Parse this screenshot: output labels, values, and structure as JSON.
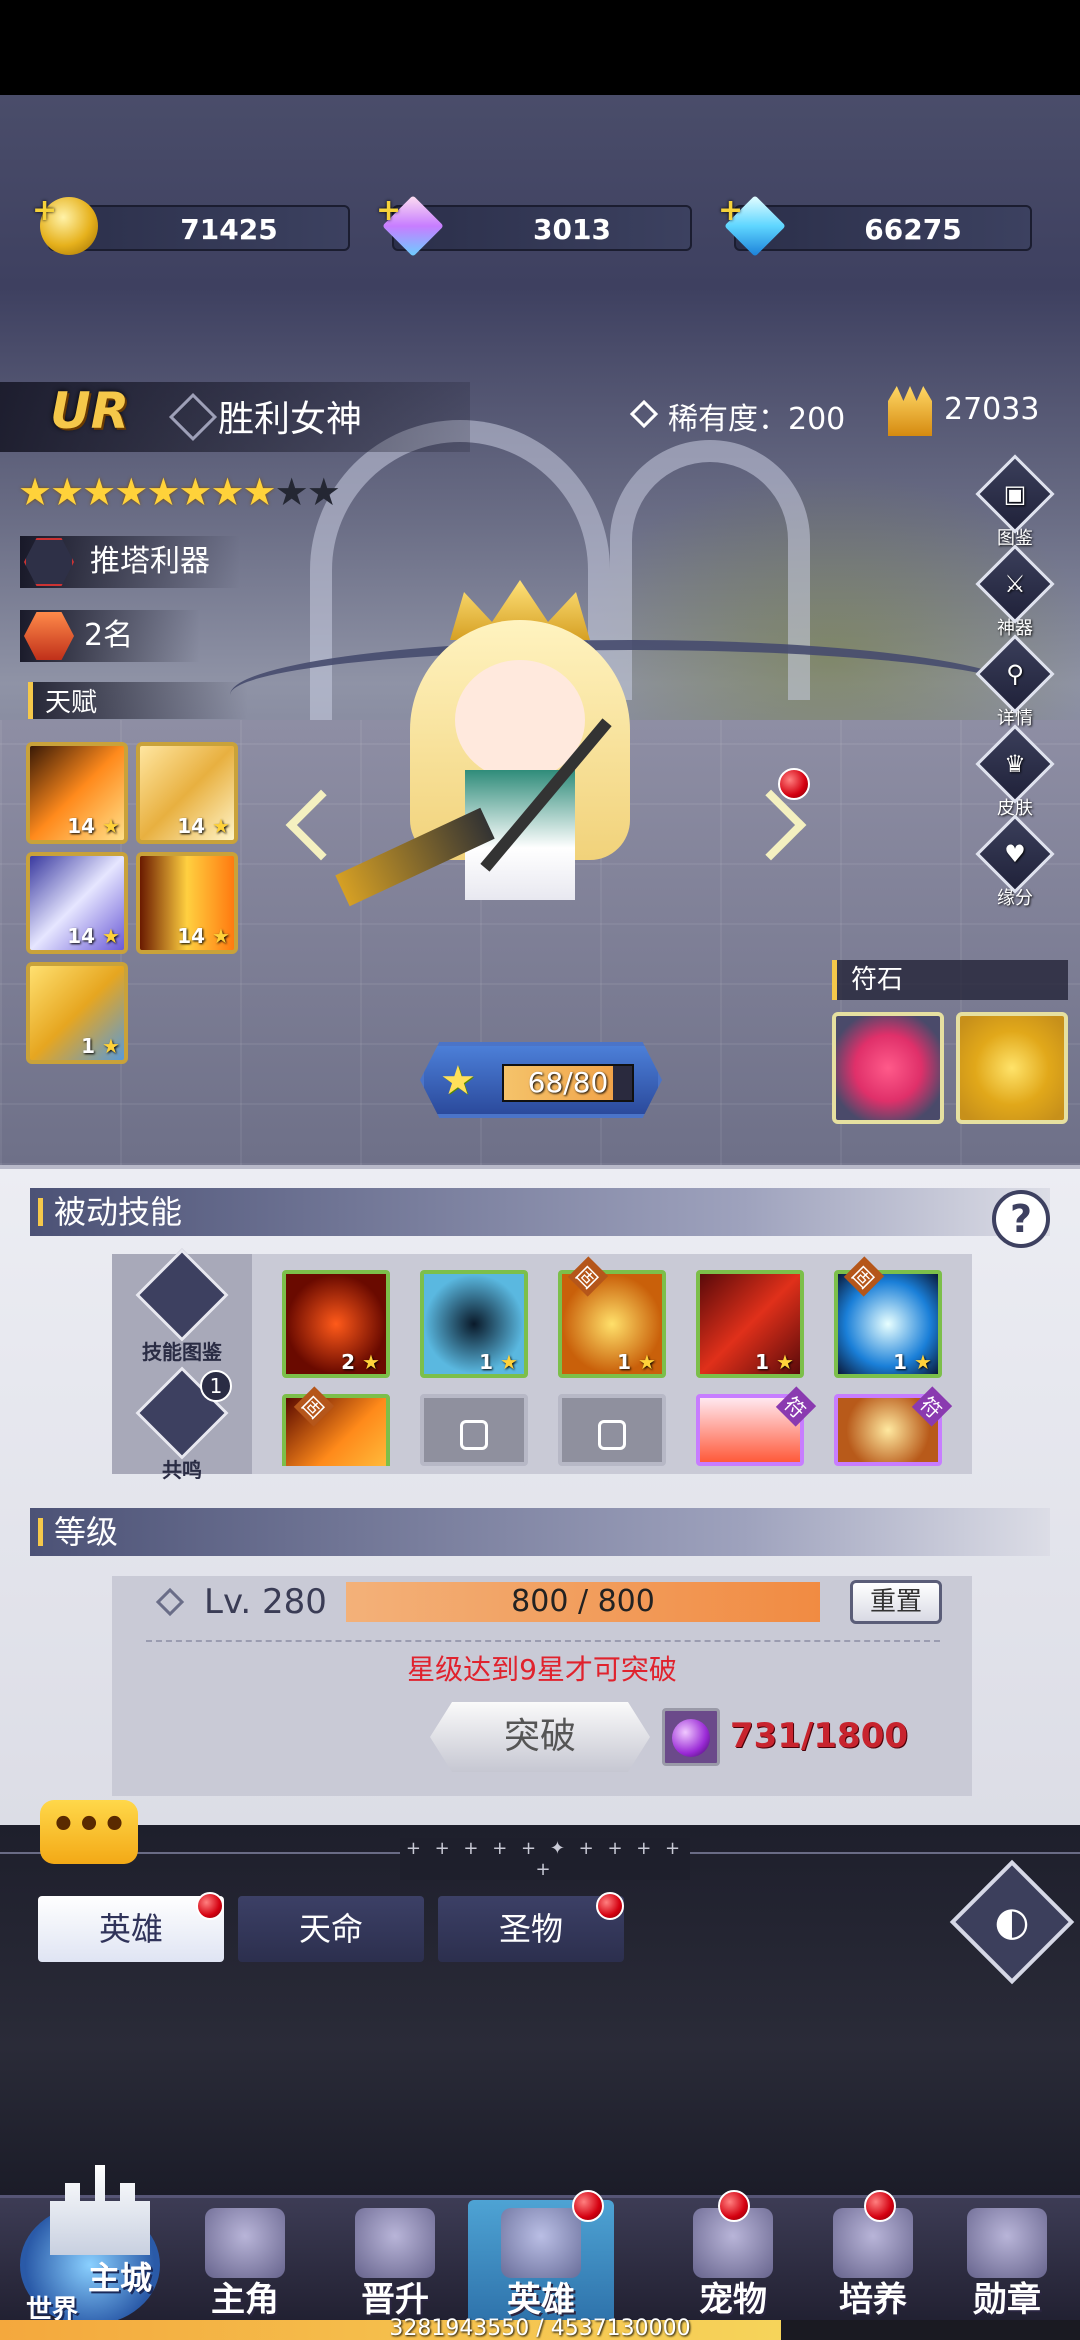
{
  "currency": {
    "gold": "71425",
    "gem": "3013",
    "diamond": "66275"
  },
  "hero": {
    "rarity_grade": "UR",
    "name": "胜利女神",
    "rarity_text": "稀有度：200",
    "power": "27033",
    "stars_filled": 8,
    "stars_total": 10,
    "tag": "推塔利器",
    "rank": "2名",
    "talent_label": "天赋",
    "talent_skills": [
      {
        "level": "14"
      },
      {
        "level": "14"
      },
      {
        "level": "14"
      },
      {
        "level": "14"
      },
      {
        "level": "1"
      }
    ],
    "exp_text": "68/80",
    "exp_fraction": 0.85
  },
  "side_buttons": [
    "图鉴",
    "神器",
    "详情",
    "皮肤",
    "缘分"
  ],
  "rune_label": "符石",
  "passive": {
    "title": "被动技能",
    "help": "?",
    "left_buttons": [
      {
        "label": "技能图鉴"
      },
      {
        "label": "共鸣",
        "badge": "1"
      }
    ],
    "skills_row1": [
      {
        "level": "2",
        "tag": ""
      },
      {
        "level": "1",
        "tag": ""
      },
      {
        "level": "1",
        "tag": "固"
      },
      {
        "level": "1",
        "tag": ""
      },
      {
        "level": "1",
        "tag": "固"
      }
    ],
    "skills_row2_tags": [
      "固",
      "",
      "",
      "符",
      "符"
    ]
  },
  "level": {
    "title": "等级",
    "lv_text": "Lv.  280",
    "bar_text": "800 / 800",
    "bar_fraction": 1.0,
    "reset_label": "重置",
    "warning": "星级达到9星才可突破",
    "break_label": "突破",
    "cost_text": "731/1800"
  },
  "chat_icon": "•••",
  "separator": "+ + + + + ✦ + + + + +",
  "tabs": [
    {
      "label": "英雄",
      "active": true,
      "dot": true
    },
    {
      "label": "天命",
      "active": false,
      "dot": false
    },
    {
      "label": "圣物",
      "active": false,
      "dot": true
    }
  ],
  "nav": {
    "city_label": "主城",
    "world_label": "世界",
    "items": [
      {
        "label": "主角",
        "dot": false,
        "active": false
      },
      {
        "label": "晋升",
        "dot": false,
        "active": false
      },
      {
        "label": "英雄",
        "dot": true,
        "active": true
      },
      {
        "label": "宠物",
        "dot": true,
        "active": false
      },
      {
        "label": "培养",
        "dot": true,
        "active": false
      },
      {
        "label": "勋章",
        "dot": false,
        "active": false
      }
    ]
  },
  "progress": {
    "text": "3281943550 / 4537130000",
    "fraction": 0.723
  },
  "colors": {
    "accent_gold": "#f5c84a",
    "warning_red": "#e0222d",
    "badge_red": "#d40010"
  }
}
